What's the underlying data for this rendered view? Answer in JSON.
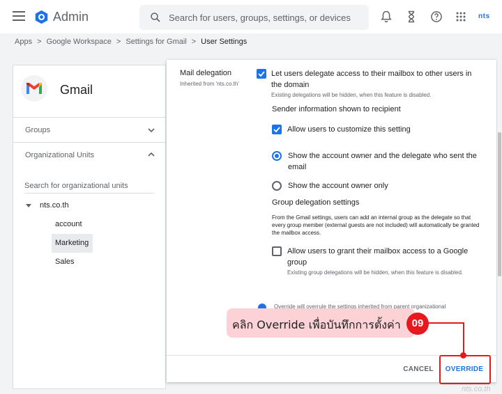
{
  "header": {
    "app_title": "Admin",
    "search_placeholder": "Search for users, groups, settings, or devices",
    "brand": "nts"
  },
  "breadcrumb": [
    "Apps",
    "Google Workspace",
    "Settings for Gmail",
    "User Settings"
  ],
  "sidebar": {
    "title": "Gmail",
    "groups_label": "Groups",
    "org_units_label": "Organizational Units",
    "ou_search_placeholder": "Search for organizational units",
    "tree": {
      "root": "nts.co.th",
      "children": [
        "account",
        "Marketing",
        "Sales"
      ],
      "selected": "Marketing"
    }
  },
  "setting": {
    "name": "Mail delegation",
    "inherited": "Inherited from 'nts.co.th'",
    "delegate_label": "Let users delegate access to their mailbox to other users in the domain",
    "delegate_note": "Existing delegations will be hidden, when this feature is disabled.",
    "sender_info_heading": "Sender information shown to recipient",
    "customize_label": "Allow users to customize this setting",
    "radio_both": "Show the account owner and the delegate who sent the email",
    "radio_owner": "Show the account owner only",
    "group_heading": "Group delegation settings",
    "group_desc": "From the Gmail settings, users can add an internal group as the delegate so that every group member (external guests are not included) will automatically be granted the mailbox access.",
    "group_label": "Allow users to grant their mailbox access to a Google group",
    "group_note": "Existing group delegations will be hidden, when this feature is disabled.",
    "override_note": "Override will overrule the settings inherited from parent organizational"
  },
  "buttons": {
    "cancel": "CANCEL",
    "override": "OVERRIDE"
  },
  "annotation": {
    "text": "คลิก Override เพื่อบันทึกการตั้งค่า",
    "step": "09",
    "watermark": "nts.co.th"
  },
  "colors": {
    "accent": "#1a73e8",
    "annotation_red": "#e8191c",
    "callout_bg": "#fcd2d6"
  }
}
